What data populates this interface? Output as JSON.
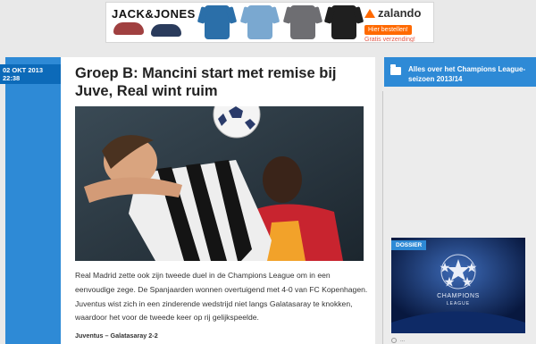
{
  "ad": {
    "brand": "JACK&JONES",
    "zalando_logo": "zalando",
    "order_button": "Hier bestellen!",
    "shipping": "Gratis verzending!",
    "product_colors": [
      "#a04040",
      "#2a3b5c",
      "#2b6fa9",
      "#7aa8d0",
      "#6e6e72",
      "#1f1f1f"
    ]
  },
  "article": {
    "date_line1": "02 OKT 2013",
    "date_line2": "22:38",
    "title": "Groep B: Mancini start met remise bij Juve, Real wint ruim",
    "lead": "Real Madrid zette ook zijn tweede duel in de Champions League om in een eenvoudige zege. De Spanjaarden wonnen overtuigend met 4-0 van FC Kopenhagen. Juventus wist zich in een zinderende wedstrijd niet langs Galatasaray te knokken, waardoor het voor de tweede keer op rij gelijkspeelde.",
    "score_line": "Juventus – Galatasaray 2-2"
  },
  "sidebar": {
    "category_label": "Alles over het Champions League-seizoen 2013/14",
    "folder_icon": "folder-icon",
    "dossier_tag": "DOSSIER",
    "dossier_logo_text": "CHAMPIONS",
    "dossier_logo_sub": "LEAGUE",
    "meta_text": "..."
  },
  "colors": {
    "accent_blue": "#2e8ad6",
    "dark_blue": "#0c6ab9",
    "zalando_orange": "#ff6900"
  }
}
